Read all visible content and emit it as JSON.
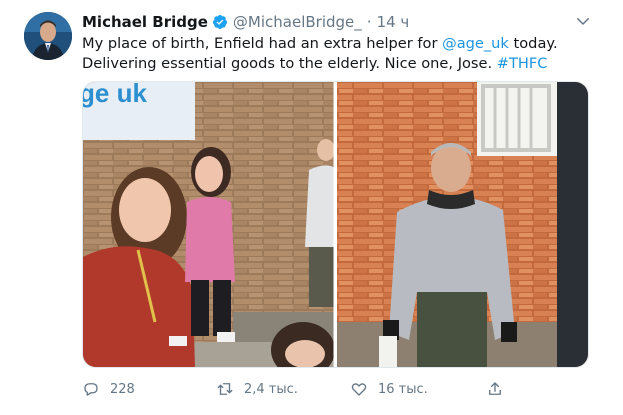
{
  "author": {
    "name": "Michael Bridge",
    "handle": "@MichaelBridge_",
    "separator": "·",
    "time": "14 ч"
  },
  "tweet": {
    "text_1": "My place of birth, Enfield had an extra helper for ",
    "mention": "@age_uk",
    "text_2": " today. Delivering essential goods to the elderly. Nice one, Jose. ",
    "hashtag": "#THFC"
  },
  "media": {
    "sign_text": "ge uk"
  },
  "actions": {
    "replies": "228",
    "retweets": "2,4 тыс.",
    "likes": "16 тыс."
  },
  "colors": {
    "link": "#1b95e0",
    "verified": "#1da1f2",
    "muted": "#657786"
  },
  "icons": [
    "verified-badge-icon",
    "chevron-down-icon",
    "reply-icon",
    "retweet-icon",
    "like-icon",
    "share-icon"
  ]
}
